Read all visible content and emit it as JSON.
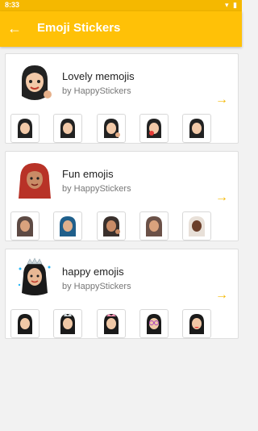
{
  "status_bar": {
    "time": "8:33",
    "wifi_icon": "wifi-icon",
    "battery_icon": "battery-icon"
  },
  "app_bar": {
    "back_icon": "arrow-left-icon",
    "title": "Emoji Stickers"
  },
  "packs": [
    {
      "name": "Lovely memojis",
      "author": "by HappyStickers",
      "arrow_icon": "arrow-right-icon",
      "sticker_count": 5
    },
    {
      "name": "Fun emojis",
      "author": "by HappyStickers",
      "arrow_icon": "arrow-right-icon",
      "sticker_count": 5
    },
    {
      "name": "happy emojis",
      "author": "by HappyStickers",
      "arrow_icon": "arrow-right-icon",
      "sticker_count": 5
    }
  ],
  "colors": {
    "accent": "#ffc107",
    "arrow": "#f5b800"
  }
}
